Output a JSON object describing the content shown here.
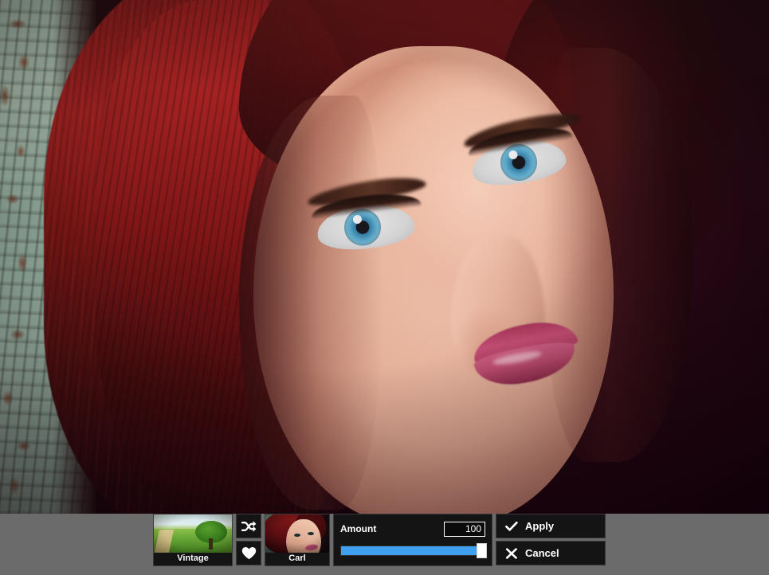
{
  "app": {
    "type": "photo-filter-editor",
    "canvas_alt": "Close-up portrait of a woman with deep red hair and blue eyes against a weathered teal painted wall"
  },
  "toolbar": {
    "preset": {
      "name": "Vintage",
      "thumbnail": "landscape-tree-thumbnail",
      "icon_name": "vintage-preset-thumbnail"
    },
    "random_button": {
      "label": "",
      "icon_name": "shuffle-icon"
    },
    "favorite_button": {
      "label": "",
      "icon_name": "heart-icon"
    },
    "source": {
      "name": "Carl",
      "thumbnail": "portrait-thumbnail",
      "icon_name": "carl-source-thumbnail"
    },
    "amount": {
      "label": "Amount",
      "value": "100",
      "placeholder": "0",
      "slider_percent": 100,
      "slider_min": 0,
      "slider_max": 100,
      "fill_color": "#3fa0ef",
      "handle_color": "#ffffff"
    },
    "apply_button": {
      "label": "Apply",
      "icon_name": "check-icon"
    },
    "cancel_button": {
      "label": "Cancel",
      "icon_name": "close-x-icon"
    }
  },
  "colors": {
    "toolbar_bg": "#6b6b6b",
    "panel_bg": "#141414",
    "panel_border": "#3a3a3a",
    "text": "#ffffff",
    "accent": "#3fa0ef"
  }
}
